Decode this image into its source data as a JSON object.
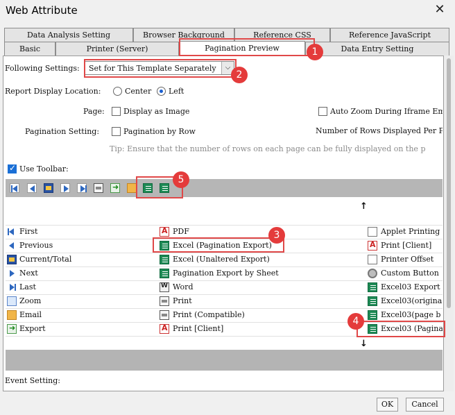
{
  "window": {
    "title": "Web Attribute",
    "close_glyph": "✕"
  },
  "tabs_row1": [
    "Data Analysis Setting",
    "Browser Background",
    "Reference CSS",
    "Reference JavaScript"
  ],
  "tabs_row2": [
    "Basic",
    "Printer (Server)",
    "Pagination Preview",
    "Data Entry Setting"
  ],
  "active_tab": "Pagination Preview",
  "following": {
    "label": "Following Settings:",
    "value": "Set for This Template Separately"
  },
  "display_location": {
    "label": "Report Display Location:",
    "center": "Center",
    "left": "Left",
    "selected": "Left"
  },
  "page": {
    "label": "Page:",
    "display_as_image": "Display as Image",
    "auto_zoom": "Auto Zoom During Iframe Emb"
  },
  "pagination_setting": {
    "label": "Pagination Setting:",
    "by_row": "Pagination by Row",
    "rows_per_page": "Number of Rows Displayed Per P"
  },
  "tip": "Tip: Ensure that the number of rows on each page can be fully displayed on the p",
  "use_toolbar": {
    "label": "Use Toolbar:",
    "checked": true
  },
  "grid": {
    "col1": [
      "First",
      "Previous",
      "Current/Total",
      "Next",
      "Last",
      "Zoom",
      "Email",
      "Export"
    ],
    "col2": [
      "PDF",
      "Excel (Pagination Export)",
      "Excel (Unaltered Export)",
      "Pagination Export by Sheet",
      "Word",
      "Print",
      "Print (Compatible)",
      "Print [Client]"
    ],
    "col3": [
      "Applet Printing",
      "Print [Client]",
      "Printer Offset",
      "Custom Button",
      "Excel03 Export",
      "Excel03(origina",
      "Excel03(page b",
      "Excel03 (Pagina"
    ]
  },
  "arrows": {
    "up": "↑",
    "down": "↓"
  },
  "event_setting": "Event Setting:",
  "buttons": {
    "ok": "OK",
    "cancel": "Cancel"
  },
  "badges": [
    "1",
    "2",
    "3",
    "4",
    "5"
  ],
  "colors": {
    "highlight": "#e04848",
    "badge": "#e43b3b",
    "toolbar": "#b6b6b6"
  }
}
